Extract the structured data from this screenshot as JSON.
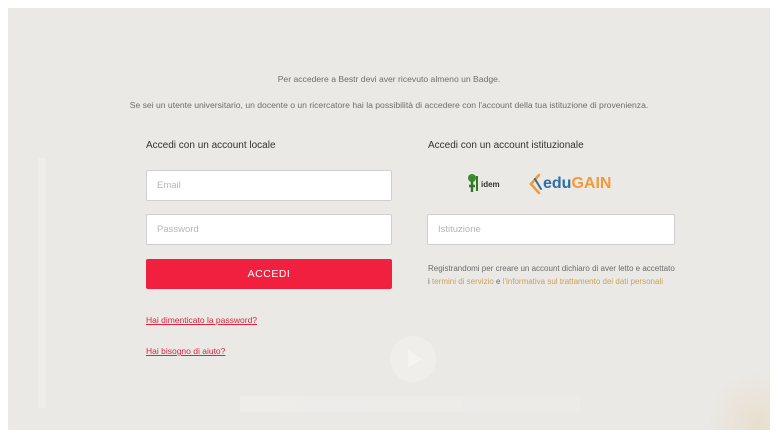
{
  "intro": {
    "line1": "Per accedere a Bestr devi aver ricevuto almeno un Badge.",
    "line2": "Se sei un utente universitario, un docente o un ricercatore hai la possibilità di accedere con l'account della tua istituzione di provenienza."
  },
  "local": {
    "title": "Accedi con un account locale",
    "email_placeholder": "Email",
    "password_placeholder": "Password",
    "login_button": "ACCEDI",
    "forgot_link": "Hai dimenticato la password?",
    "help_link": "Hai bisogno di aiuto?"
  },
  "institutional": {
    "title": "Accedi con un account istituzionale",
    "idem_logo_text": "idem",
    "edugain_edu": "edu",
    "edugain_gain": "GAIN",
    "institution_placeholder": "Istituzione",
    "terms_prefix": "Registrandomi per creare un account dichiaro di aver letto e accettato i ",
    "terms_link": "termini di servizio",
    "terms_mid": " e ",
    "privacy_link": "l'informativa sul trattamento dei dati personali"
  },
  "colors": {
    "accent": "#f0203e",
    "link": "#e0243f",
    "panel_bg": "#ebe9e6",
    "edugain_blue": "#2d6ea5",
    "edugain_orange": "#f29a3a"
  }
}
